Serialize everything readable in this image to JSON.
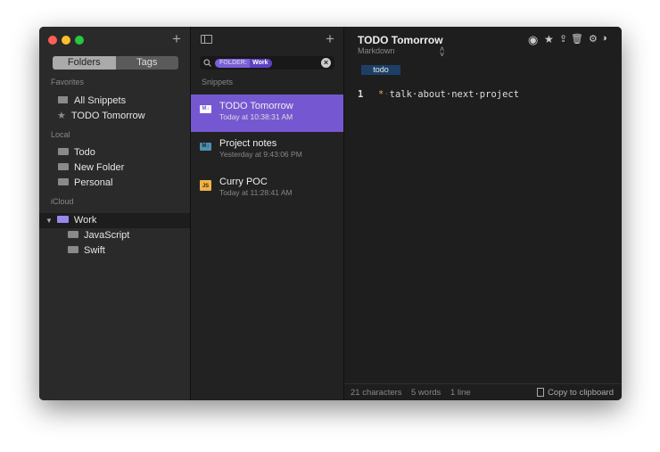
{
  "colors": {
    "accent": "#7558d1",
    "tag_bg": "#1d3f66",
    "close": "#ff5f57",
    "minimize": "#febc2e",
    "zoom": "#28c840"
  },
  "sidebar": {
    "tabs": [
      {
        "label": "Folders",
        "active": true
      },
      {
        "label": "Tags",
        "active": false
      }
    ],
    "sections": {
      "favorites": "Favorites",
      "local": "Local",
      "icloud": "iCloud"
    },
    "favorites": [
      {
        "label": "All Snippets",
        "icon": "tray-icon"
      },
      {
        "label": "TODO Tomorrow",
        "icon": "star-icon"
      }
    ],
    "local": [
      {
        "label": "Todo"
      },
      {
        "label": "New Folder"
      },
      {
        "label": "Personal"
      }
    ],
    "icloud": [
      {
        "label": "Work",
        "selected": true,
        "expanded": true,
        "children": [
          {
            "label": "JavaScript"
          },
          {
            "label": "Swift"
          }
        ]
      }
    ]
  },
  "list": {
    "search": {
      "filter_key": "FOLDER:",
      "filter_value": "Work"
    },
    "section": "Snippets",
    "snippets": [
      {
        "title": "TODO Tomorrow",
        "date": "Today at 10:38:31 AM",
        "type": "M↓",
        "selected": true
      },
      {
        "title": "Project notes",
        "date": "Yesterday at 9:43:06 PM",
        "type": "M↓",
        "selected": false
      },
      {
        "title": "Curry POC",
        "date": "Today at 11:28:41 AM",
        "type": "JS",
        "selected": false
      }
    ]
  },
  "editor": {
    "title": "TODO Tomorrow",
    "language": "Markdown",
    "tag": "todo",
    "lines": [
      {
        "num": "1",
        "bullet": "*",
        "text": "talk·about·next·project"
      }
    ],
    "footer": {
      "chars": "21 characters",
      "words": "5 words",
      "lines": "1 line",
      "copy": "Copy to clipboard"
    }
  }
}
